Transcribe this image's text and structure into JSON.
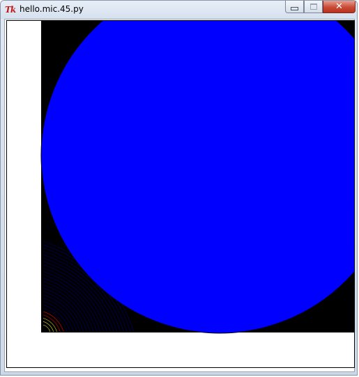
{
  "window": {
    "title": "hello.mic.45.py",
    "app_icon": "tk-icon",
    "app_icon_text": "Tk",
    "buttons": {
      "minimize": "minimize-icon",
      "maximize": "maximize-icon",
      "close": "close-icon",
      "close_glyph": "✕"
    }
  },
  "canvas": {
    "background": "#ffffff",
    "fill_square_color": "#000000",
    "circle_color": "#0000ff",
    "trace_colors": [
      "#0000ff",
      "#ff0000",
      "#ffff00"
    ]
  }
}
